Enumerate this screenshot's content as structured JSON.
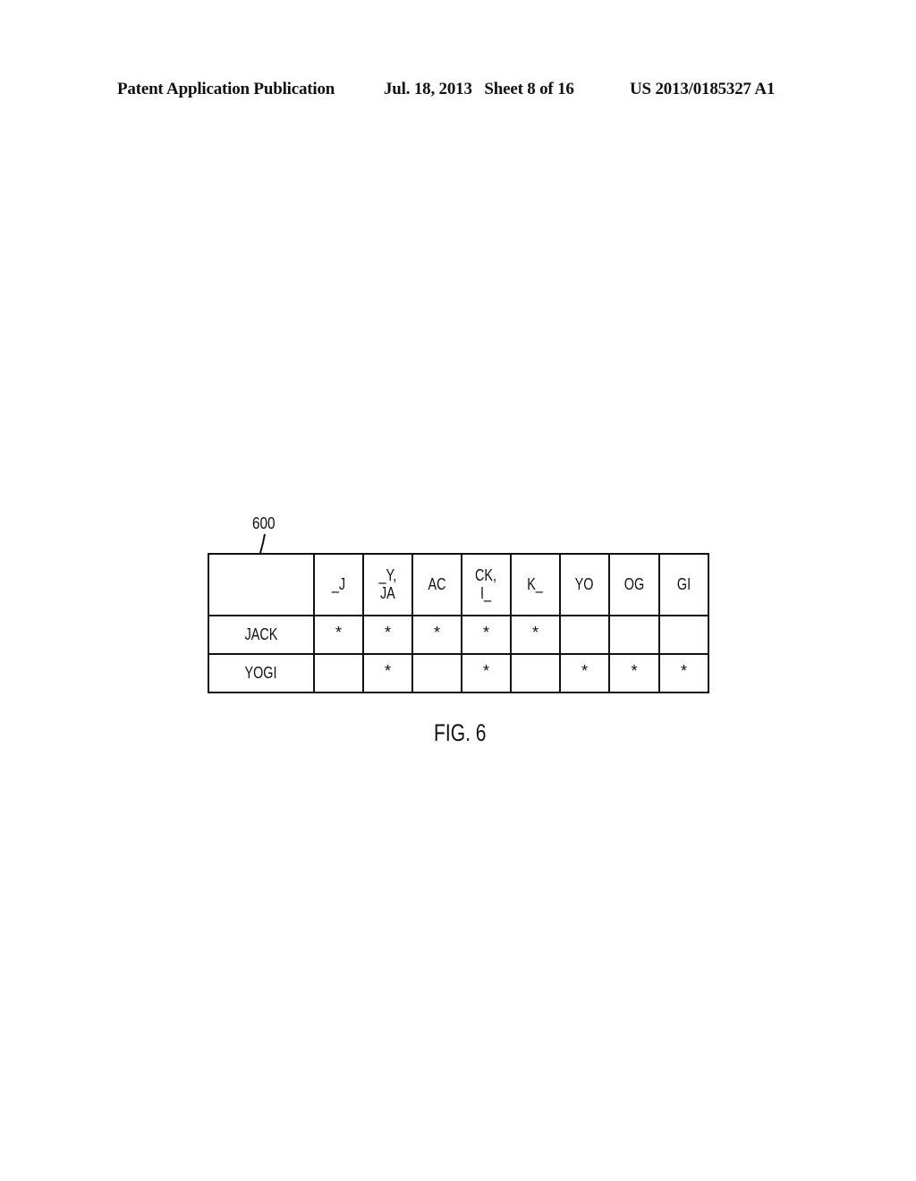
{
  "header": {
    "publication": "Patent Application Publication",
    "date_sheet": "Jul. 18, 2013   Sheet 8 of 16",
    "number": "US 2013/0185327 A1"
  },
  "figure": {
    "reference": "600",
    "caption": "FIG. 6",
    "table": {
      "columns": [
        "_J",
        "_Y, JA",
        "AC",
        "CK, I_",
        "K_",
        "YO",
        "OG",
        "GI"
      ],
      "column_lines": [
        [
          "_J"
        ],
        [
          "_Y,",
          "JA"
        ],
        [
          "AC"
        ],
        [
          "CK,",
          "I_"
        ],
        [
          "K_"
        ],
        [
          "YO"
        ],
        [
          "OG"
        ],
        [
          "GI"
        ]
      ],
      "rows": [
        {
          "label": "JACK",
          "cells": [
            "*",
            "*",
            "*",
            "*",
            "*",
            "",
            "",
            ""
          ]
        },
        {
          "label": "YOGI",
          "cells": [
            "",
            "*",
            "",
            "*",
            "",
            "*",
            "*",
            "*"
          ]
        }
      ]
    }
  }
}
